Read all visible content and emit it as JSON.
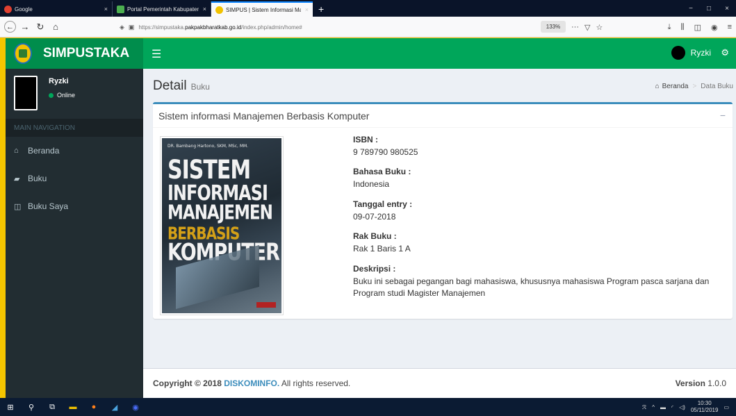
{
  "browser": {
    "tabs": [
      {
        "title": "Google",
        "favicon_color": "#e04030",
        "close": "×"
      },
      {
        "title": "Portal Pemerintah Kabupaten Pa",
        "favicon_color": "#4caf50",
        "close": "×"
      },
      {
        "title": "SIMPUS | Sistem Informasi Man",
        "favicon_color": "#f2c200",
        "close": "×"
      }
    ],
    "new_tab": "+",
    "url_prefix": "https://simpustaka.",
    "url_host": "pakpakbharatkab.go.id",
    "url_path": "/index.php/admin/home#",
    "zoom": "133%",
    "window_controls": [
      "−",
      "□",
      "×"
    ]
  },
  "header": {
    "logo_text": "SIMPUSTAKA",
    "menu_icon": "☰",
    "user_name": "Ryzki",
    "cogs_icon": "⚙"
  },
  "sidebar": {
    "user_name": "Ryzki",
    "user_status": "Online",
    "nav_header": "MAIN NAVIGATION",
    "items": [
      {
        "label": "Beranda",
        "icon": "⌂"
      },
      {
        "label": "Buku",
        "icon": "▰"
      },
      {
        "label": "Buku Saya",
        "icon": "◫"
      }
    ]
  },
  "page": {
    "title": "Detail",
    "subtitle": "Buku",
    "breadcrumb_home": "Beranda",
    "breadcrumb_current": "Data Buku",
    "breadcrumb_sep": ">",
    "breadcrumb_icon": "⌂"
  },
  "book": {
    "title": "Sistem informasi Manajemen Berbasis Komputer",
    "collapse_icon": "−",
    "cover": {
      "author": "DR. Bambang Hartono, SKM, MSc, MM.",
      "line1": "SISTEM",
      "line2": "INFORMASI",
      "line3": "MANAJEMEN",
      "line4": "BERBASIS",
      "line5": "KOMPUTER"
    },
    "fields": [
      {
        "label": "ISBN :",
        "value": "9 789790 980525"
      },
      {
        "label": "Bahasa Buku :",
        "value": "Indonesia"
      },
      {
        "label": "Tanggal entry :",
        "value": "09-07-2018"
      },
      {
        "label": "Rak Buku :",
        "value": "Rak 1 Baris 1 A"
      },
      {
        "label": "Deskripsi :",
        "value": "Buku ini sebagai pegangan bagi mahasiswa, khususnya mahasiswa Program pasca sarjana dan Program studi Magister Manajemen"
      }
    ]
  },
  "footer": {
    "copyright_prefix": "Copyright © 2018",
    "brand": "DISKOMINFO.",
    "rights": "All rights reserved.",
    "version_label": "Version",
    "version_value": "1.0.0"
  },
  "taskbar": {
    "time": "10:30",
    "date": "05/11/2019"
  }
}
